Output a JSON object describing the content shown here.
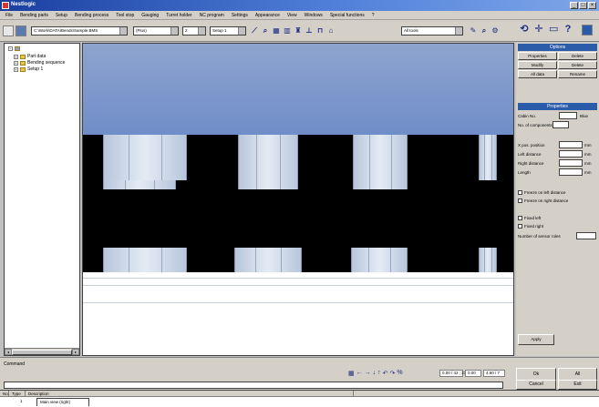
{
  "window": {
    "title": "Nestlogic"
  },
  "menu": [
    "File",
    "Bending parts",
    "Setup",
    "Bending process",
    "Tool stop",
    "Gauging",
    "Turret holder",
    "NC program",
    "Settings",
    "Appearance",
    "View",
    "Windows",
    "Special functions",
    "?"
  ],
  "toolbar": {
    "file_combo": "C:\\Work\\DATA\\Bends\\Sample.BMS",
    "combo2": "(Plus)",
    "combo3": "2",
    "combo4": "Setup 1",
    "combo5": "All tools",
    "icons": [
      "save-icon",
      "open-icon",
      "line-icon",
      "zoom-icon",
      "grid-icon",
      "tool-icon",
      "gauge-icon",
      "bend-icon",
      "stamp-icon"
    ]
  },
  "tree": {
    "root": "",
    "items": [
      "Part data",
      "Bending sequence",
      "Setup 1"
    ]
  },
  "right_panel": {
    "options_header": "Options",
    "buttons": [
      [
        "Properties",
        "Delete"
      ],
      [
        "Modify",
        "Delete"
      ],
      [
        "All data",
        "Rename"
      ]
    ],
    "properties_header": "Properties",
    "fields": [
      {
        "label": "Cabin No.",
        "unit": "Blue"
      },
      {
        "label": "No. of components",
        "unit": ""
      }
    ],
    "position_fields": [
      {
        "label": "X pos. position",
        "unit": "mm"
      },
      {
        "label": "Left distance",
        "unit": "mm"
      },
      {
        "label": "Right distance",
        "unit": "mm"
      },
      {
        "label": "Length",
        "unit": "mm"
      }
    ],
    "checks": [
      "Freeze on left distance",
      "Freeze on right distance"
    ],
    "checks2": [
      "Fixed left",
      "Fixed right"
    ],
    "segments_label": "Number of sensor roles",
    "apply_label": "Apply"
  },
  "command": {
    "label": "Command",
    "coords": [
      "0.00 / 42 ; 23.00",
      "0.00",
      "4.60 / 7"
    ],
    "ok_label": "Ok",
    "all_label": "All",
    "cancel_label": "Cancel",
    "exit_label": "Exit"
  },
  "bottom_list": {
    "columns": [
      "No.",
      "Type",
      "Description"
    ],
    "row_number": "1",
    "tab_label": "Main view (right)"
  },
  "colors": {
    "title_blue": "#1a3fa0",
    "panel_header": "#2a5caa",
    "sky": "#7f97cb"
  }
}
